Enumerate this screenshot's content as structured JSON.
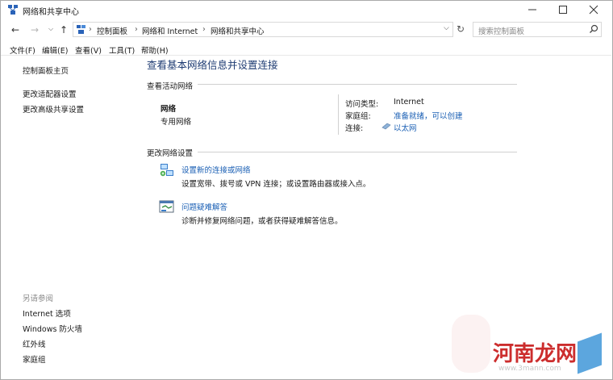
{
  "window": {
    "title": "网络和共享中心",
    "controls": {
      "minimize": "—",
      "maximize": "☐",
      "close": "✕"
    }
  },
  "address": {
    "path": [
      "控制面板",
      "网络和 Internet",
      "网络和共享中心"
    ],
    "search_placeholder": "搜索控制面板"
  },
  "menu": [
    "文件(F)",
    "编辑(E)",
    "查看(V)",
    "工具(T)",
    "帮助(H)"
  ],
  "sidebar": {
    "home": "控制面板主页",
    "links": [
      "更改适配器设置",
      "更改高级共享设置"
    ],
    "see_also_title": "另请参阅",
    "see_also": [
      "Internet 选项",
      "Windows 防火墙",
      "红外线",
      "家庭组"
    ]
  },
  "main": {
    "title": "查看基本网络信息并设置连接",
    "active_section": "查看活动网络",
    "network_name": "网络",
    "network_type": "专用网络",
    "access_label": "访问类型:",
    "access_value": "Internet",
    "homegroup_label": "家庭组:",
    "homegroup_value": "准备就绪，可以创建",
    "conn_label": "连接:",
    "conn_value": "以太网",
    "change_section": "更改网络设置",
    "tasks": [
      {
        "title": "设置新的连接或网络",
        "desc": "设置宽带、拨号或 VPN 连接；或设置路由器或接入点。"
      },
      {
        "title": "问题疑难解答",
        "desc": "诊断并修复网络问题，或者获得疑难解答信息。"
      }
    ]
  },
  "watermark": {
    "text": "河南龙网",
    "url": "www.3mann.com"
  }
}
